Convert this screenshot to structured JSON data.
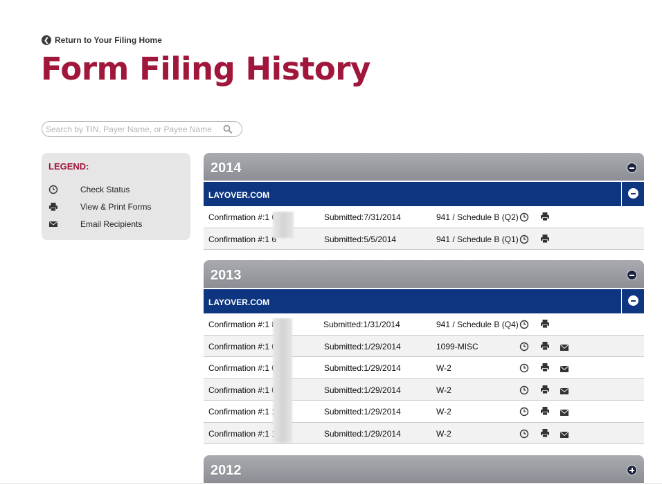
{
  "nav": {
    "back_label": "Return to Your Filing Home"
  },
  "page": {
    "title": "Form Filing History"
  },
  "search": {
    "placeholder": "Search by TIN, Payer Name, or Payee Name"
  },
  "legend": {
    "title": "LEGEND:",
    "items": [
      {
        "icon": "clock-icon",
        "label": "Check Status"
      },
      {
        "icon": "printer-icon",
        "label": "View & Print Forms"
      },
      {
        "icon": "envelope-icon",
        "label": "Email Recipients"
      }
    ]
  },
  "years": [
    {
      "year": "2014",
      "expanded": true,
      "payers": [
        {
          "name": "LAYOVER.COM",
          "filings": [
            {
              "confirmation": "Confirmation #:1      6",
              "submitted": "Submitted:7/31/2014",
              "form": "941 / Schedule B (Q2)",
              "email": false
            },
            {
              "confirmation": "Confirmation #:1      6",
              "submitted": "Submitted:5/5/2014",
              "form": "941 / Schedule B (Q1)",
              "email": false
            }
          ]
        }
      ]
    },
    {
      "year": "2013",
      "expanded": true,
      "payers": [
        {
          "name": "LAYOVER.COM",
          "filings": [
            {
              "confirmation": "Confirmation #:1      8",
              "submitted": "Submitted:1/31/2014",
              "form": "941 / Schedule B (Q4)",
              "email": false
            },
            {
              "confirmation": "Confirmation #:1      03",
              "submitted": "Submitted:1/29/2014",
              "form": "1099-MISC",
              "email": true
            },
            {
              "confirmation": "Confirmation #:1      02",
              "submitted": "Submitted:1/29/2014",
              "form": "W-2",
              "email": true
            },
            {
              "confirmation": "Confirmation #:1      01",
              "submitted": "Submitted:1/29/2014",
              "form": "W-2",
              "email": true
            },
            {
              "confirmation": "Confirmation #:1      13",
              "submitted": "Submitted:1/29/2014",
              "form": "W-2",
              "email": true
            },
            {
              "confirmation": "Confirmation #:1      12",
              "submitted": "Submitted:1/29/2014",
              "form": "W-2",
              "email": true
            }
          ]
        }
      ]
    },
    {
      "year": "2012",
      "expanded": false,
      "payers": []
    }
  ],
  "colors": {
    "title": "#a0173b",
    "payer_bar": "#0d3580",
    "year_bar": "#969aa0"
  }
}
